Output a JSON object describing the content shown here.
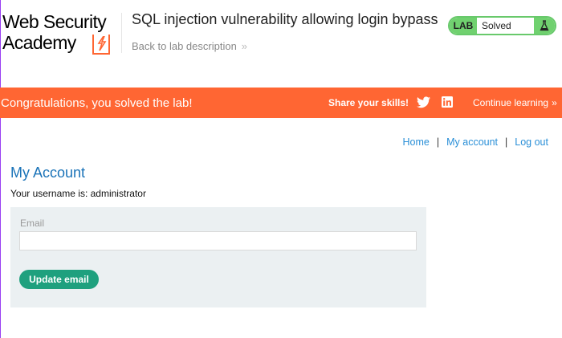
{
  "header": {
    "logo_line1": "Web Security",
    "logo_line2": "Academy",
    "lab_title": "SQL injection vulnerability allowing login bypass",
    "back_link": "Back to lab description",
    "status_tag": "LAB",
    "status_value": "Solved"
  },
  "banner": {
    "message": "Congratulations, you solved the lab!",
    "share_label": "Share your skills!",
    "continue_label": "Continue learning"
  },
  "nav": {
    "home": "Home",
    "separator": "|",
    "my_account": "My account",
    "logout": "Log out"
  },
  "main": {
    "title": "My Account",
    "username_text": "Your username is: administrator",
    "email_label": "Email",
    "email_value": "",
    "update_button": "Update email"
  },
  "colors": {
    "accent": "#ff6633",
    "link": "#2a8fd7",
    "heading": "#1a73b8",
    "success": "#70d16f",
    "button": "#1fa07e"
  }
}
